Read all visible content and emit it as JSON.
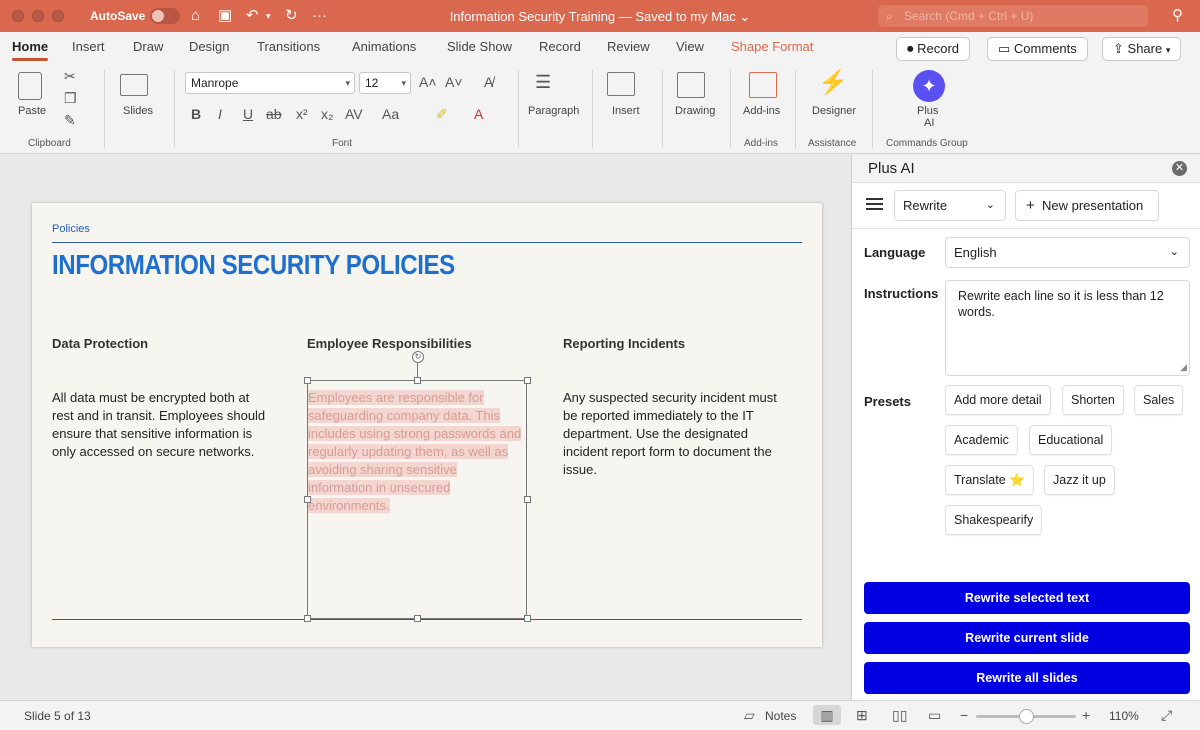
{
  "window": {
    "autosave_label": "AutoSave",
    "title": "Information Security Training — Saved to my Mac ⌄",
    "search_placeholder": "Search (Cmd + Ctrl + U)"
  },
  "tabs": [
    "Home",
    "Insert",
    "Draw",
    "Design",
    "Transitions",
    "Animations",
    "Slide Show",
    "Record",
    "Review",
    "View",
    "Shape Format"
  ],
  "top_buttons": {
    "record": "Record",
    "comments": "Comments",
    "share": "Share"
  },
  "ribbon": {
    "paste": "Paste",
    "clipboard": "Clipboard",
    "slides": "Slides",
    "font_name": "Manrope",
    "font_size": "12",
    "font": "Font",
    "paragraph": "Paragraph",
    "insert": "Insert",
    "drawing": "Drawing",
    "addins_btn": "Add-ins",
    "addins_group": "Add-ins",
    "designer": "Designer",
    "assistance": "Assistance",
    "plus_ai_line1": "Plus",
    "plus_ai_line2": "AI",
    "commands_group": "Commands Group"
  },
  "slide": {
    "crumb": "Policies",
    "title": "INFORMATION SECURITY POLICIES",
    "columns": [
      {
        "heading": "Data Protection",
        "body": "All data must be encrypted both at rest and in transit. Employees should ensure that sensitive information is only accessed on secure networks."
      },
      {
        "heading": "Employee Responsibilities",
        "body": "Employees are responsible for safeguarding company data. This includes using strong passwords and regularly updating them, as well as avoiding sharing sensitive information in unsecured environments."
      },
      {
        "heading": "Reporting Incidents",
        "body": "Any suspected security incident must be reported immediately to the IT department. Use the designated incident report form to document the issue."
      }
    ]
  },
  "panel": {
    "title": "Plus AI",
    "mode": "Rewrite",
    "new_presentation": "New presentation",
    "language_label": "Language",
    "language_value": "English",
    "instructions_label": "Instructions",
    "instructions_value": "Rewrite each line so it is less than 12 words.",
    "presets_label": "Presets",
    "presets": [
      "Add more detail",
      "Shorten",
      "Sales",
      "Academic",
      "Educational",
      "Translate ⭐",
      "Jazz it up",
      "Shakespearify"
    ],
    "actions": [
      "Rewrite selected text",
      "Rewrite current slide",
      "Rewrite all slides"
    ]
  },
  "status": {
    "slide_counter": "Slide 5 of 13",
    "notes": "Notes",
    "zoom": "110%"
  },
  "colors": {
    "title_bar": "#d9684f",
    "accent_blue": "#0000e0",
    "slide_title": "#1f6fd1"
  }
}
